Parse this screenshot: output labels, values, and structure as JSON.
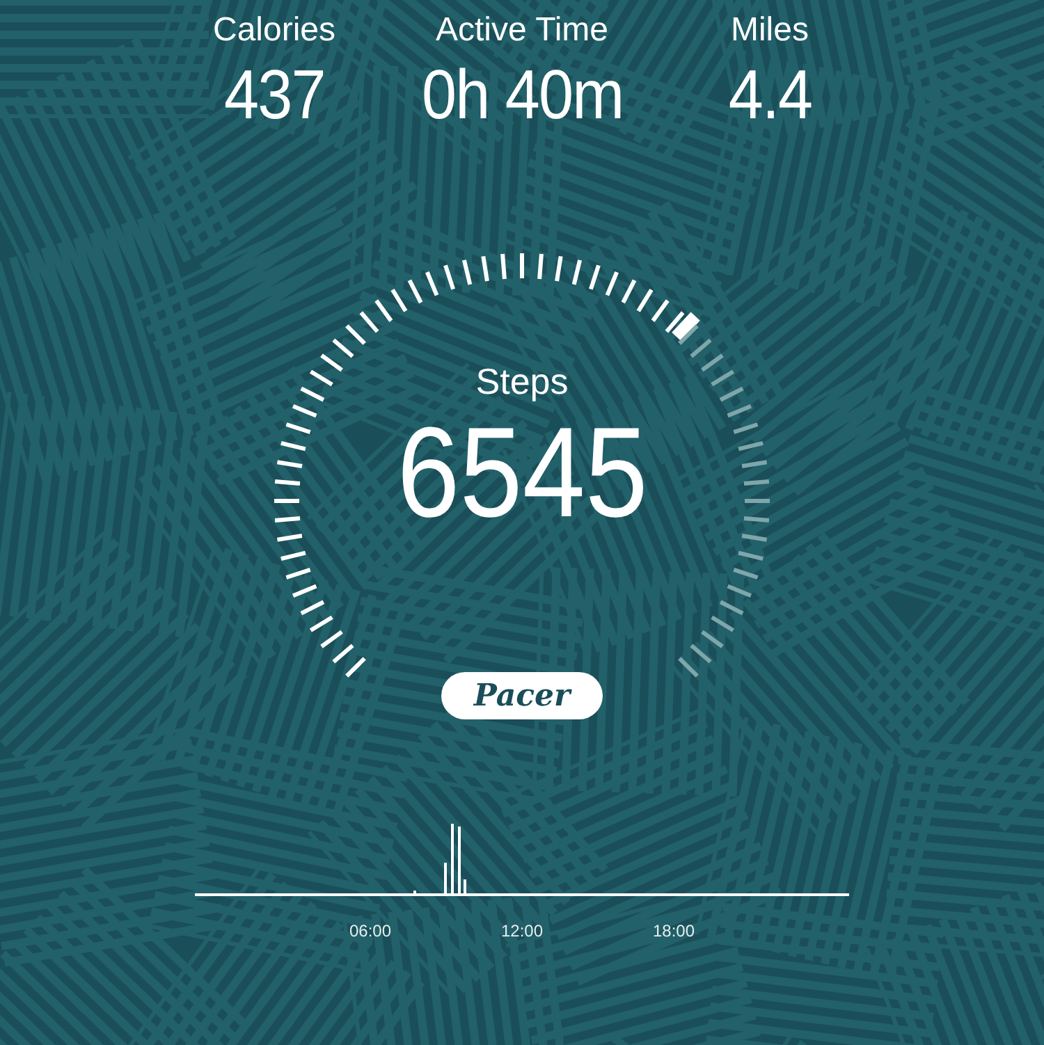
{
  "stats": [
    {
      "label": "Calories",
      "value": "437"
    },
    {
      "label": "Active Time",
      "value": "0h 40m"
    },
    {
      "label": "Miles",
      "value": "4.4"
    }
  ],
  "gauge": {
    "label": "Steps",
    "value": "6545"
  },
  "brand_button": {
    "label": "Pacer"
  },
  "activity_chart": {
    "time_labels": [
      "06:00",
      "12:00",
      "18:00"
    ]
  }
}
